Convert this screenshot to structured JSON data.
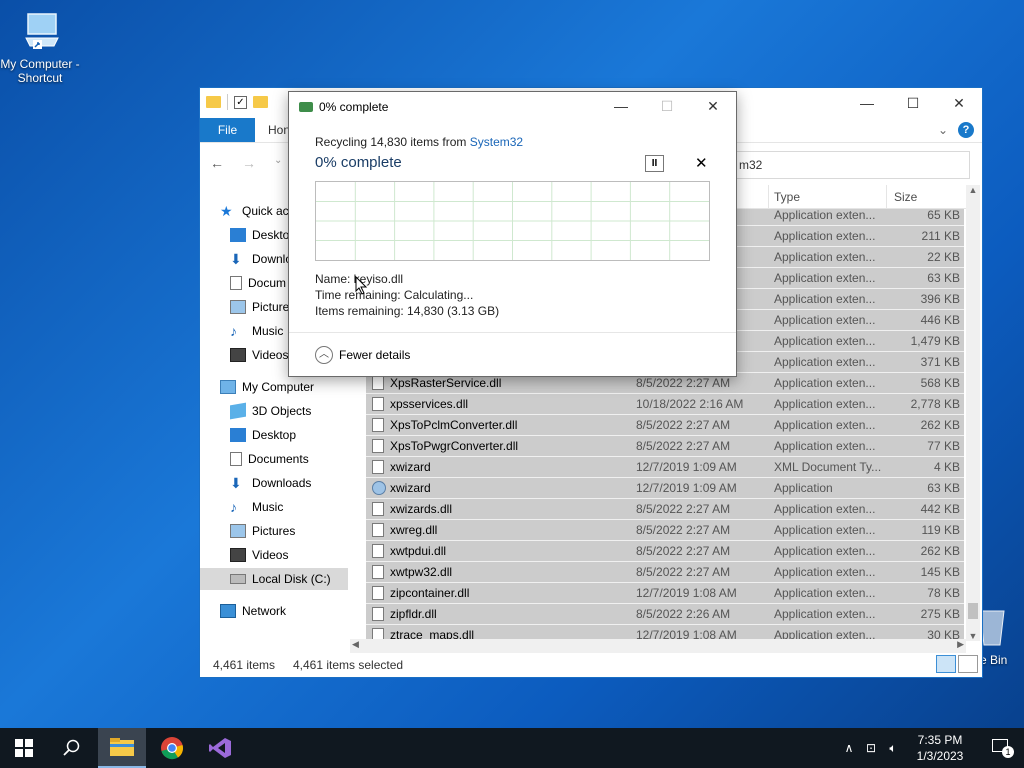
{
  "desktop": {
    "icon_label": "My Computer - Shortcut",
    "recycle_label": "e Bin"
  },
  "explorer": {
    "ribbon": {
      "file_tab": "File",
      "home_tab": "Hon"
    },
    "address_partial": "m32",
    "columns": {
      "type": "Type",
      "size": "Size"
    },
    "nav": {
      "quick_access": "Quick ac",
      "quick_items": [
        "Deskto",
        "Downlo",
        "Docum",
        "Picture",
        "Music",
        "Videos"
      ],
      "my_computer": "My Computer",
      "pc_items": [
        "3D Objects",
        "Desktop",
        "Documents",
        "Downloads",
        "Music",
        "Pictures",
        "Videos"
      ],
      "local_disk": "Local Disk (C:)",
      "network": "Network"
    },
    "rows": [
      {
        "name": "",
        "date": "",
        "type": "Application exten...",
        "size": "65 KB",
        "icon": "dll"
      },
      {
        "name": "",
        "date": "",
        "type": "Application exten...",
        "size": "211 KB",
        "icon": "dll"
      },
      {
        "name": "",
        "date": "",
        "type": "Application exten...",
        "size": "22 KB",
        "icon": "dll"
      },
      {
        "name": "",
        "date": "",
        "type": "Application exten...",
        "size": "63 KB",
        "icon": "dll"
      },
      {
        "name": "",
        "date": "",
        "type": "Application exten...",
        "size": "396 KB",
        "icon": "dll"
      },
      {
        "name": "",
        "date": "",
        "type": "Application exten...",
        "size": "446 KB",
        "icon": "dll"
      },
      {
        "name": "",
        "date": "",
        "type": "Application exten...",
        "size": "1,479 KB",
        "icon": "dll"
      },
      {
        "name": "",
        "date": "",
        "type": "Application exten...",
        "size": "371 KB",
        "icon": "dll"
      },
      {
        "name": "XpsRasterService.dll",
        "date": "8/5/2022 2:27 AM",
        "type": "Application exten...",
        "size": "568 KB",
        "icon": "dll"
      },
      {
        "name": "xpsservices.dll",
        "date": "10/18/2022 2:16 AM",
        "type": "Application exten...",
        "size": "2,778 KB",
        "icon": "dll"
      },
      {
        "name": "XpsToPclmConverter.dll",
        "date": "8/5/2022 2:27 AM",
        "type": "Application exten...",
        "size": "262 KB",
        "icon": "dll"
      },
      {
        "name": "XpsToPwgrConverter.dll",
        "date": "8/5/2022 2:27 AM",
        "type": "Application exten...",
        "size": "77 KB",
        "icon": "dll"
      },
      {
        "name": "xwizard",
        "date": "12/7/2019 1:09 AM",
        "type": "XML Document Ty...",
        "size": "4 KB",
        "icon": "xml"
      },
      {
        "name": "xwizard",
        "date": "12/7/2019 1:09 AM",
        "type": "Application",
        "size": "63 KB",
        "icon": "app"
      },
      {
        "name": "xwizards.dll",
        "date": "8/5/2022 2:27 AM",
        "type": "Application exten...",
        "size": "442 KB",
        "icon": "dll"
      },
      {
        "name": "xwreg.dll",
        "date": "8/5/2022 2:27 AM",
        "type": "Application exten...",
        "size": "119 KB",
        "icon": "dll"
      },
      {
        "name": "xwtpdui.dll",
        "date": "8/5/2022 2:27 AM",
        "type": "Application exten...",
        "size": "262 KB",
        "icon": "dll"
      },
      {
        "name": "xwtpw32.dll",
        "date": "8/5/2022 2:27 AM",
        "type": "Application exten...",
        "size": "145 KB",
        "icon": "dll"
      },
      {
        "name": "zipcontainer.dll",
        "date": "12/7/2019 1:08 AM",
        "type": "Application exten...",
        "size": "78 KB",
        "icon": "dll"
      },
      {
        "name": "zipfldr.dll",
        "date": "8/5/2022 2:26 AM",
        "type": "Application exten...",
        "size": "275 KB",
        "icon": "dll"
      },
      {
        "name": "ztrace_maps.dll",
        "date": "12/7/2019 1:08 AM",
        "type": "Application exten...",
        "size": "30 KB",
        "icon": "dll"
      }
    ],
    "status": {
      "items": "4,461 items",
      "selected": "4,461 items selected"
    }
  },
  "dialog": {
    "title": "0% complete",
    "recycling_prefix": "Recycling 14,830 items from ",
    "recycling_source": "System32",
    "percent_label": "0% complete",
    "progress_fraction": 0,
    "name_line": "Name:  keyiso.dll",
    "time_line": "Time remaining:  Calculating...",
    "items_line": "Items remaining:  14,830 (3.13 GB)",
    "fewer_details": "Fewer details"
  },
  "taskbar": {
    "time": "7:35 PM",
    "date": "1/3/2023",
    "notification_count": "1"
  },
  "colors": {
    "accent": "#1979ca",
    "selection": "#cccccc",
    "graph_grid": "#cfe8cf"
  }
}
